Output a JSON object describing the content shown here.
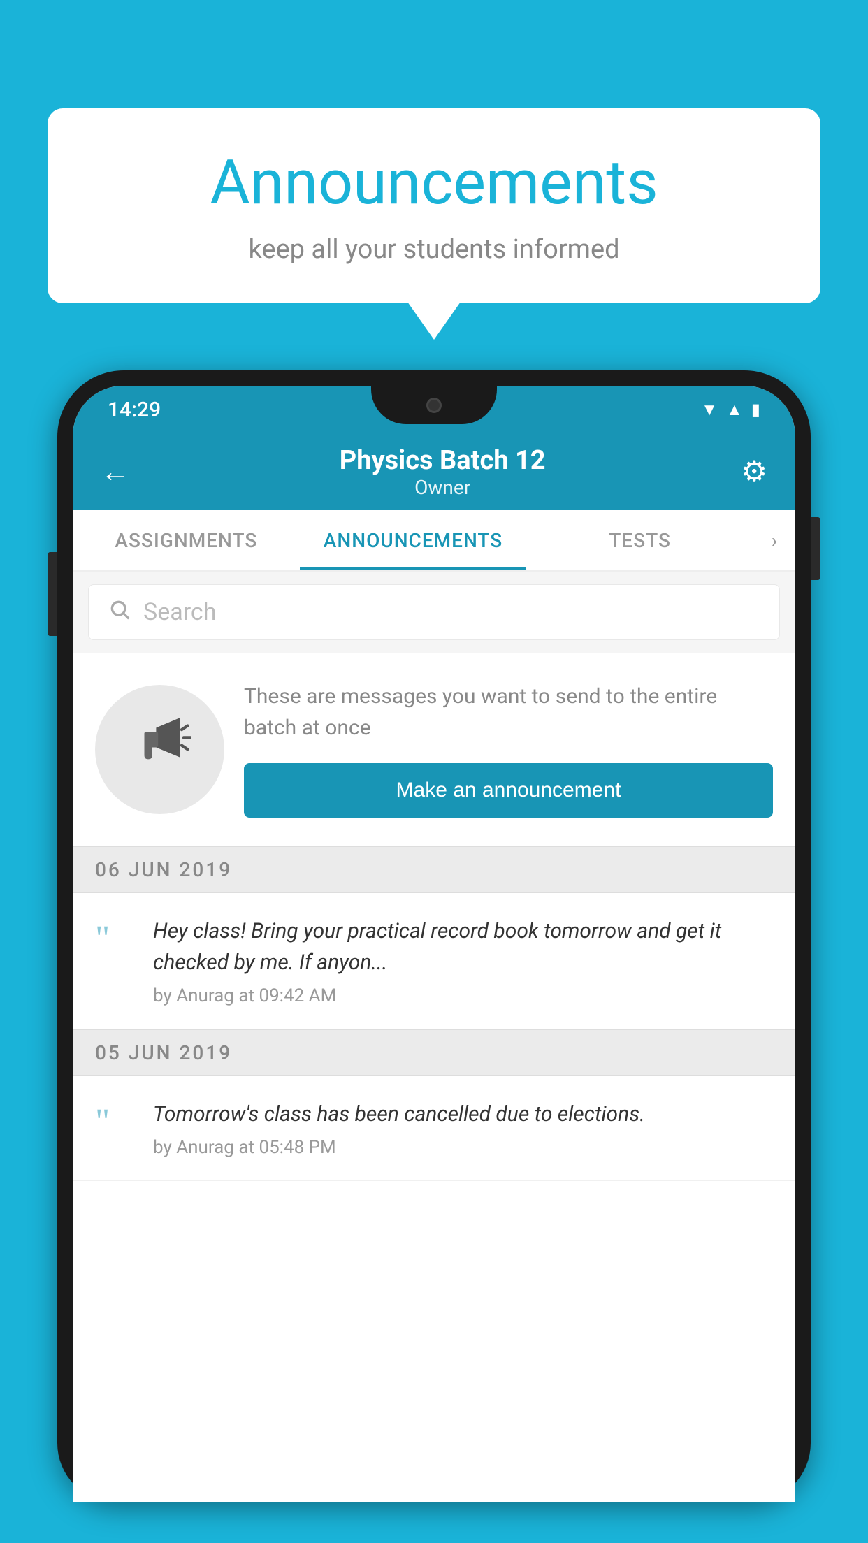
{
  "page": {
    "background_color": "#1ab3d8"
  },
  "speech_bubble": {
    "title": "Announcements",
    "subtitle": "keep all your students informed"
  },
  "status_bar": {
    "time": "14:29",
    "icons": [
      "wifi",
      "signal",
      "battery"
    ]
  },
  "app_bar": {
    "title": "Physics Batch 12",
    "subtitle": "Owner",
    "back_label": "←",
    "settings_label": "⚙"
  },
  "tabs": [
    {
      "label": "ASSIGNMENTS",
      "active": false
    },
    {
      "label": "ANNOUNCEMENTS",
      "active": true
    },
    {
      "label": "TESTS",
      "active": false
    }
  ],
  "search": {
    "placeholder": "Search"
  },
  "announcement_promo": {
    "description_text": "These are messages you want to send to the entire batch at once",
    "button_label": "Make an announcement"
  },
  "announcement_groups": [
    {
      "date": "06  JUN  2019",
      "items": [
        {
          "text": "Hey class! Bring your practical record book tomorrow and get it checked by me. If anyon...",
          "meta": "by Anurag at 09:42 AM"
        }
      ]
    },
    {
      "date": "05  JUN  2019",
      "items": [
        {
          "text": "Tomorrow's class has been cancelled due to elections.",
          "meta": "by Anurag at 05:48 PM"
        }
      ]
    }
  ]
}
